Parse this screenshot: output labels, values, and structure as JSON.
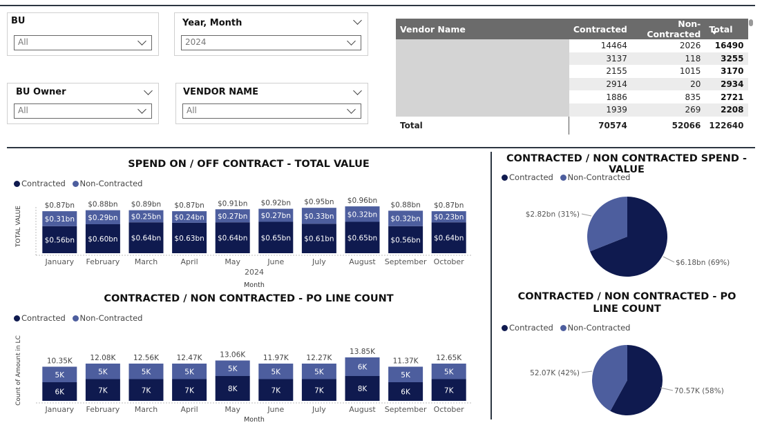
{
  "slicers": {
    "bu": {
      "title": "BU",
      "value": "All"
    },
    "year_month": {
      "title": "Year, Month",
      "value": "2024"
    },
    "bu_owner": {
      "title": "BU Owner",
      "value": "All"
    },
    "vendor_name": {
      "title": "VENDOR NAME",
      "value": "All"
    }
  },
  "vendor_table": {
    "headers": {
      "vendor": "Vendor Name",
      "contracted": "Contracted",
      "non_contracted": "Non-Contracted",
      "total": "Total"
    },
    "rows": [
      {
        "contracted": "14464",
        "non_contracted": "2026",
        "total": "16490"
      },
      {
        "contracted": "3137",
        "non_contracted": "118",
        "total": "3255"
      },
      {
        "contracted": "2155",
        "non_contracted": "1015",
        "total": "3170"
      },
      {
        "contracted": "2914",
        "non_contracted": "20",
        "total": "2934"
      },
      {
        "contracted": "1886",
        "non_contracted": "835",
        "total": "2721"
      },
      {
        "contracted": "1939",
        "non_contracted": "269",
        "total": "2208"
      }
    ],
    "total": {
      "label": "Total",
      "contracted": "70574",
      "non_contracted": "52066",
      "total": "122640"
    }
  },
  "legend": {
    "contracted": "Contracted",
    "non_contracted": "Non-Contracted"
  },
  "colors": {
    "contracted": "#0f1a4f",
    "non_contracted": "#4d5e9e"
  },
  "chart_data": [
    {
      "type": "bar",
      "stacked": true,
      "title": "SPEND ON / OFF CONTRACT - TOTAL VALUE",
      "ylabel": "TOTAL VALUE",
      "xlabel": "Month",
      "year_label": "2024",
      "categories": [
        "January",
        "February",
        "March",
        "April",
        "May",
        "June",
        "July",
        "August",
        "September",
        "October"
      ],
      "series": [
        {
          "name": "Contracted",
          "values": [
            0.56,
            0.6,
            0.64,
            0.63,
            0.64,
            0.65,
            0.61,
            0.65,
            0.56,
            0.64
          ],
          "labels": [
            "$0.56bn",
            "$0.60bn",
            "$0.64bn",
            "$0.63bn",
            "$0.64bn",
            "$0.65bn",
            "$0.61bn",
            "$0.65bn",
            "$0.56bn",
            "$0.64bn"
          ]
        },
        {
          "name": "Non-Contracted",
          "values": [
            0.31,
            0.29,
            0.25,
            0.24,
            0.27,
            0.27,
            0.33,
            0.32,
            0.32,
            0.23
          ],
          "labels": [
            "$0.31bn",
            "$0.29bn",
            "$0.25bn",
            "$0.24bn",
            "$0.27bn",
            "$0.27bn",
            "$0.33bn",
            "$0.32bn",
            "$0.32bn",
            "$0.23bn"
          ]
        }
      ],
      "totals": [
        "$0.87bn",
        "$0.88bn",
        "$0.89bn",
        "$0.87bn",
        "$0.91bn",
        "$0.92bn",
        "$0.95bn",
        "$0.96bn",
        "$0.88bn",
        "$0.87bn"
      ],
      "total_values": [
        0.87,
        0.88,
        0.89,
        0.87,
        0.91,
        0.92,
        0.95,
        0.96,
        0.88,
        0.87
      ]
    },
    {
      "type": "bar",
      "stacked": true,
      "title": "CONTRACTED / NON CONTRACTED - PO LINE COUNT",
      "ylabel": "Count of Amount in LC",
      "xlabel": "Month",
      "categories": [
        "January",
        "February",
        "March",
        "April",
        "May",
        "June",
        "July",
        "August",
        "September",
        "October"
      ],
      "series": [
        {
          "name": "Contracted",
          "values": [
            6,
            7,
            7,
            7,
            8,
            7,
            7,
            8,
            6,
            7
          ],
          "labels": [
            "6K",
            "7K",
            "7K",
            "7K",
            "8K",
            "7K",
            "7K",
            "8K",
            "6K",
            "7K"
          ]
        },
        {
          "name": "Non-Contracted",
          "values": [
            5,
            5,
            5,
            5,
            5,
            5,
            5,
            6,
            5,
            5
          ],
          "labels": [
            "5K",
            "5K",
            "5K",
            "5K",
            "5K",
            "5K",
            "5K",
            "6K",
            "5K",
            "5K"
          ]
        }
      ],
      "totals": [
        "10.35K",
        "12.08K",
        "12.56K",
        "12.47K",
        "13.06K",
        "11.97K",
        "12.27K",
        "13.85K",
        "11.37K",
        "12.65K"
      ],
      "total_values": [
        10.35,
        12.08,
        12.56,
        12.47,
        13.06,
        11.97,
        12.27,
        13.85,
        11.37,
        12.65
      ]
    },
    {
      "type": "pie",
      "title": "CONTRACTED / NON CONTRACTED SPEND - VALUE",
      "slices": [
        {
          "name": "Contracted",
          "value": 69,
          "label": "$6.18bn (69%)"
        },
        {
          "name": "Non-Contracted",
          "value": 31,
          "label": "$2.82bn (31%)"
        }
      ]
    },
    {
      "type": "pie",
      "title": "CONTRACTED / NON CONTRACTED - PO LINE COUNT",
      "slices": [
        {
          "name": "Contracted",
          "value": 58,
          "label": "70.57K (58%)"
        },
        {
          "name": "Non-Contracted",
          "value": 42,
          "label": "52.07K (42%)"
        }
      ]
    }
  ]
}
